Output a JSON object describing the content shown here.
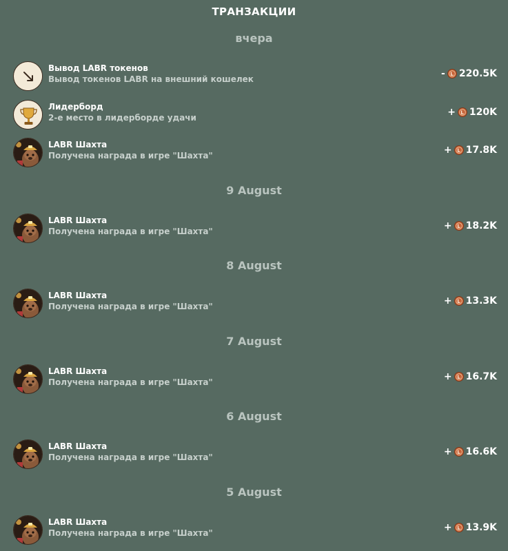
{
  "header": {
    "title": "ТРАНЗАКЦИИ"
  },
  "colors": {
    "background": "#566a61",
    "subtext": "#c7d0cc",
    "coin": "#c6643a"
  },
  "groups": [
    {
      "date": "вчера",
      "items": [
        {
          "icon": "arrow-down-right-icon",
          "title": "Вывод LABR токенов",
          "subtitle": "Вывод токенов LABR на внешний кошелек",
          "sign": "-",
          "amount": "220.5K"
        },
        {
          "icon": "trophy-icon",
          "title": "Лидерборд",
          "subtitle": "2-е место в лидерборде удачи",
          "sign": "+",
          "amount": "120K"
        },
        {
          "icon": "miner-avatar-icon",
          "title": "LABR Шахта",
          "subtitle": "Получена награда в игре \"Шахта\"",
          "sign": "+",
          "amount": "17.8K"
        }
      ]
    },
    {
      "date": "9 August",
      "items": [
        {
          "icon": "miner-avatar-icon",
          "title": "LABR Шахта",
          "subtitle": "Получена награда в игре \"Шахта\"",
          "sign": "+",
          "amount": "18.2K"
        }
      ]
    },
    {
      "date": "8 August",
      "items": [
        {
          "icon": "miner-avatar-icon",
          "title": "LABR Шахта",
          "subtitle": "Получена награда в игре \"Шахта\"",
          "sign": "+",
          "amount": "13.3K"
        }
      ]
    },
    {
      "date": "7 August",
      "items": [
        {
          "icon": "miner-avatar-icon",
          "title": "LABR Шахта",
          "subtitle": "Получена награда в игре \"Шахта\"",
          "sign": "+",
          "amount": "16.7K"
        }
      ]
    },
    {
      "date": "6 August",
      "items": [
        {
          "icon": "miner-avatar-icon",
          "title": "LABR Шахта",
          "subtitle": "Получена награда в игре \"Шахта\"",
          "sign": "+",
          "amount": "16.6K"
        }
      ]
    },
    {
      "date": "5 August",
      "items": [
        {
          "icon": "miner-avatar-icon",
          "title": "LABR Шахта",
          "subtitle": "Получена награда в игре \"Шахта\"",
          "sign": "+",
          "amount": "13.9K"
        }
      ]
    }
  ]
}
